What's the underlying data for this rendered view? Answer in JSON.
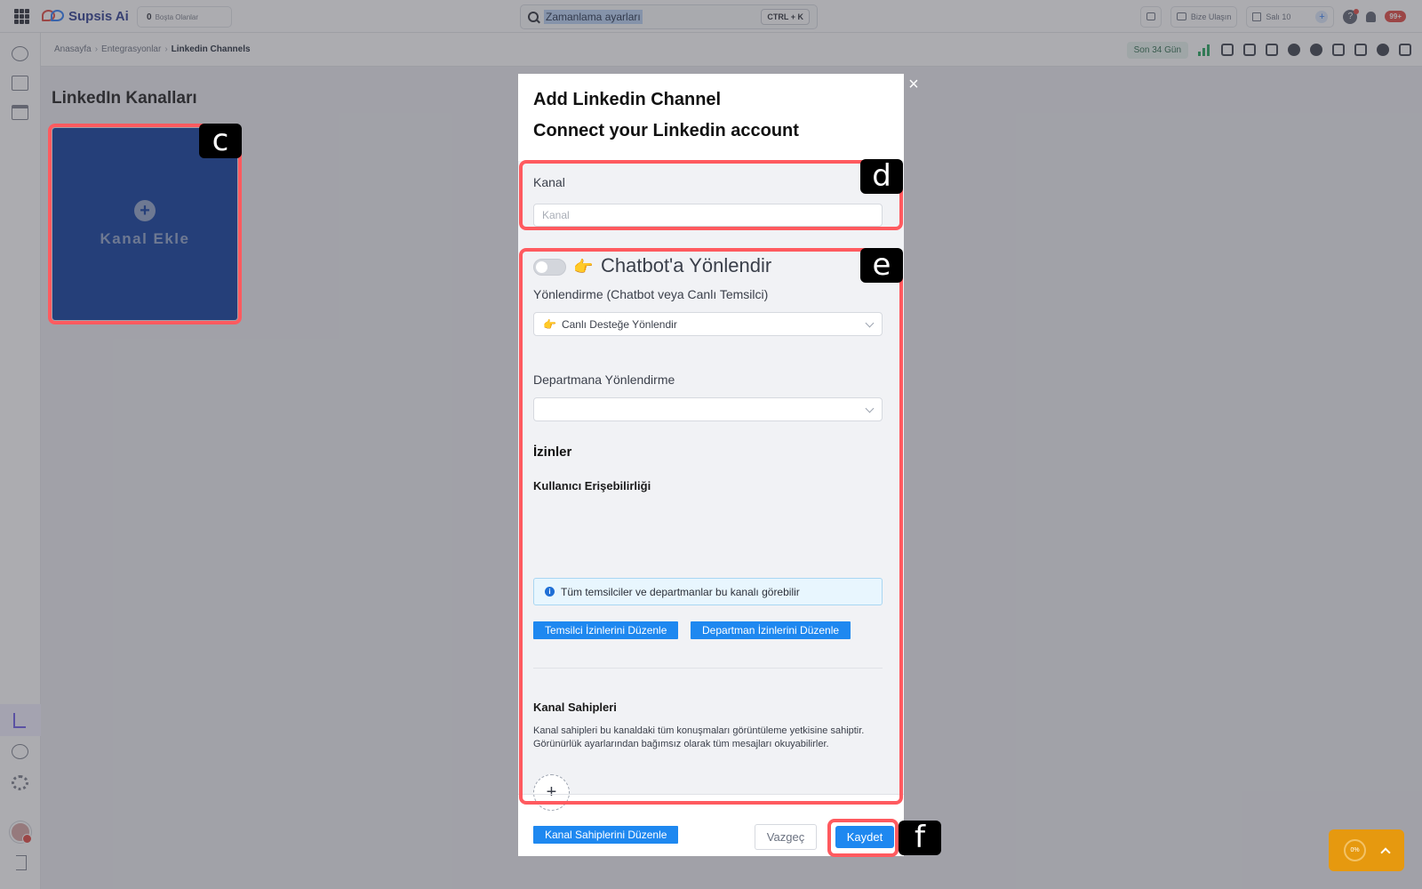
{
  "app": {
    "name": "Supsis Ai"
  },
  "topbar": {
    "idle_count": "0",
    "idle_label": "Boşta Olanlar",
    "search_value": "Zamanlama ayarları",
    "search_shortcut": "CTRL + K",
    "contact_label": "Bize Ulaşın",
    "day_label": "Salı 10",
    "notification_badge": "99+"
  },
  "breadcrumb": {
    "items": [
      "Anasayfa",
      "Entegrasyonlar",
      "Linkedin Channels"
    ],
    "separator": "›"
  },
  "subheader": {
    "date_range": "Son 34 Gün"
  },
  "page": {
    "title": "LinkedIn Kanalları",
    "add_card_label": "Kanal Ekle",
    "add_card_icon": "plus-icon",
    "add_card_color": "#0a3a9c"
  },
  "modal": {
    "title": "Add Linkedin Channel",
    "subtitle": "Connect your Linkedin account",
    "channel_label": "Kanal",
    "channel_placeholder": "Kanal",
    "channel_value": "",
    "chatbot_toggle_on": false,
    "chatbot_title": "Chatbot'a Yönlendir",
    "routing_label": "Yönlendirme (Chatbot veya Canlı Temsilci)",
    "routing_value": "Canlı Desteğe Yönlendir",
    "department_label": "Departmana Yönlendirme",
    "department_value": "",
    "permissions_title": "İzinler",
    "user_access_title": "Kullanıcı Erişebilirliği",
    "user_access_info": "Tüm temsilciler ve departmanlar bu kanalı görebilir",
    "edit_agent_perms": "Temsilci İzinlerini Düzenle",
    "edit_dept_perms": "Departman İzinlerini Düzenle",
    "owners_title": "Kanal Sahipleri",
    "owners_desc": "Kanal sahipleri bu kanaldaki tüm konuşmaları görüntüleme yetkisine sahiptir. Görünürlük ayarlarından bağımsız olarak tüm mesajları okuyabilirler.",
    "edit_owners": "Kanal Sahiplerini Düzenle",
    "cancel_label": "Vazgeç",
    "save_label": "Kaydet",
    "close_symbol": "×"
  },
  "annotations": {
    "c": "c",
    "d": "d",
    "e": "e",
    "f": "f"
  },
  "widget": {
    "progress_label": "0%",
    "progress": 0
  },
  "colors": {
    "primary": "#1e88f0",
    "highlight": "#ff5a5f",
    "accent": "#e6990f",
    "card": "#0a3a9c"
  }
}
